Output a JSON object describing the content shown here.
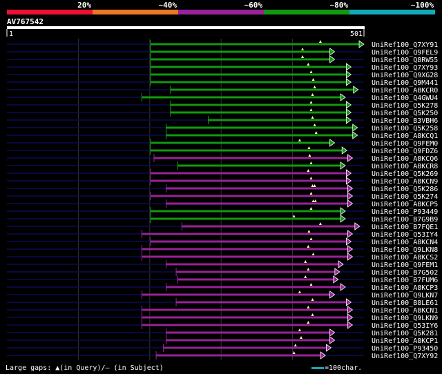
{
  "chart_data": {
    "type": "alignment-overview",
    "query_id": "AV767542",
    "query_start": "1",
    "query_end": "501",
    "query_length": 501,
    "identity_legend": [
      {
        "label": "20%",
        "color": "#ee1133"
      },
      {
        "label": "~40%",
        "color": "#ee7722"
      },
      {
        "label": "~60%",
        "color": "#992299"
      },
      {
        "label": "~80%",
        "color": "#119911"
      },
      {
        "label": "~100%",
        "color": "#11aabb"
      }
    ],
    "footer_text": "Large gaps: ▲(in Query)/— (in Subject)",
    "scale_text": "=100char.",
    "hits": [
      {
        "name": "UniRef100_Q7XY91",
        "start": 202,
        "end": 501,
        "identity": "~80%",
        "gaps": [
          440
        ]
      },
      {
        "name": "UniRef100_Q9FEL9",
        "start": 202,
        "end": 460,
        "identity": "~80%",
        "gaps": [
          415
        ]
      },
      {
        "name": "UniRef100_Q8RW55",
        "start": 202,
        "end": 460,
        "identity": "~80%",
        "gaps": [
          415
        ]
      },
      {
        "name": "UniRef100_Q7XY93",
        "start": 202,
        "end": 483,
        "identity": "~80%",
        "gaps": [
          423
        ]
      },
      {
        "name": "UniRef100_Q9XG28",
        "start": 202,
        "end": 483,
        "identity": "~80%",
        "gaps": [
          427
        ]
      },
      {
        "name": "UniRef100_Q9M441",
        "start": 202,
        "end": 483,
        "identity": "~80%",
        "gaps": [
          430
        ]
      },
      {
        "name": "UniRef100_A8KCR0",
        "start": 230,
        "end": 493,
        "identity": "~80%",
        "gaps": [
          432
        ]
      },
      {
        "name": "UniRef100_Q4GWU4",
        "start": 190,
        "end": 475,
        "identity": "~80%",
        "gaps": [
          429
        ]
      },
      {
        "name": "UniRef100_Q5K278",
        "start": 230,
        "end": 483,
        "identity": "~80%",
        "gaps": [
          427
        ]
      },
      {
        "name": "UniRef100_Q5K250",
        "start": 230,
        "end": 483,
        "identity": "~80%",
        "gaps": [
          427
        ]
      },
      {
        "name": "UniRef100_B3VBH6",
        "start": 283,
        "end": 483,
        "identity": "~80%",
        "gaps": [
          429
        ]
      },
      {
        "name": "UniRef100_Q5K258",
        "start": 224,
        "end": 492,
        "identity": "~80%",
        "gaps": [
          432
        ]
      },
      {
        "name": "UniRef100_A8KCQ1",
        "start": 224,
        "end": 492,
        "identity": "~80%",
        "gaps": [
          434
        ]
      },
      {
        "name": "UniRef100_Q9FEM0",
        "start": 202,
        "end": 460,
        "identity": "~80%",
        "gaps": [
          411
        ]
      },
      {
        "name": "UniRef100_Q9FDZ6",
        "start": 202,
        "end": 477,
        "identity": "~80%",
        "gaps": [
          424
        ]
      },
      {
        "name": "UniRef100_A8KCQ6",
        "start": 207,
        "end": 485,
        "identity": "~60%",
        "gaps": [
          425
        ]
      },
      {
        "name": "UniRef100_A8KCR8",
        "start": 240,
        "end": 475,
        "identity": "~80%",
        "gaps": [
          427
        ]
      },
      {
        "name": "UniRef100_Q5K269",
        "start": 202,
        "end": 483,
        "identity": "~60%",
        "gaps": [
          423
        ]
      },
      {
        "name": "UniRef100_A8KCN9",
        "start": 202,
        "end": 483,
        "identity": "~60%",
        "gaps": [
          427
        ]
      },
      {
        "name": "UniRef100_Q5K286",
        "start": 224,
        "end": 485,
        "identity": "~60%",
        "gaps": [
          429,
          432
        ]
      },
      {
        "name": "UniRef100_Q5K274",
        "start": 202,
        "end": 485,
        "identity": "~60%",
        "gaps": [
          427
        ]
      },
      {
        "name": "UniRef100_A8KCP5",
        "start": 224,
        "end": 485,
        "identity": "~60%",
        "gaps": [
          430,
          433
        ]
      },
      {
        "name": "UniRef100_P93449",
        "start": 202,
        "end": 475,
        "identity": "~80%",
        "gaps": [
          427
        ]
      },
      {
        "name": "UniRef100_B7G9B9",
        "start": 202,
        "end": 475,
        "identity": "~80%",
        "gaps": [
          403
        ]
      },
      {
        "name": "UniRef100_B7FQE1",
        "start": 246,
        "end": 495,
        "identity": "~60%",
        "gaps": [
          440
        ]
      },
      {
        "name": "UniRef100_Q53IY4",
        "start": 190,
        "end": 485,
        "identity": "~60%",
        "gaps": [
          424
        ]
      },
      {
        "name": "UniRef100_A8KCN4",
        "start": 202,
        "end": 483,
        "identity": "~60%",
        "gaps": [
          427
        ]
      },
      {
        "name": "UniRef100_Q9LKN8",
        "start": 190,
        "end": 485,
        "identity": "~60%",
        "gaps": [
          423
        ]
      },
      {
        "name": "UniRef100_A8KCS2",
        "start": 190,
        "end": 485,
        "identity": "~60%",
        "gaps": [
          430
        ]
      },
      {
        "name": "UniRef100_Q9FEM1",
        "start": 224,
        "end": 472,
        "identity": "~60%",
        "gaps": [
          419
        ]
      },
      {
        "name": "UniRef100_B7G502",
        "start": 238,
        "end": 467,
        "identity": "~60%",
        "gaps": [
          423
        ]
      },
      {
        "name": "UniRef100_B7FUM6",
        "start": 240,
        "end": 465,
        "identity": "~60%",
        "gaps": [
          419
        ]
      },
      {
        "name": "UniRef100_A8KCP3",
        "start": 224,
        "end": 475,
        "identity": "~60%",
        "gaps": [
          427
        ]
      },
      {
        "name": "UniRef100_Q9LKN7",
        "start": 190,
        "end": 460,
        "identity": "~60%",
        "gaps": [
          411
        ]
      },
      {
        "name": "UniRef100_B8LE61",
        "start": 238,
        "end": 483,
        "identity": "~60%",
        "gaps": [
          429
        ]
      },
      {
        "name": "UniRef100_A8KCN1",
        "start": 190,
        "end": 485,
        "identity": "~60%",
        "gaps": [
          423
        ]
      },
      {
        "name": "UniRef100_Q9LKN9",
        "start": 190,
        "end": 485,
        "identity": "~60%",
        "gaps": [
          429
        ]
      },
      {
        "name": "UniRef100_Q53IY6",
        "start": 190,
        "end": 485,
        "identity": "~60%",
        "gaps": [
          423
        ]
      },
      {
        "name": "UniRef100_Q5K281",
        "start": 224,
        "end": 460,
        "identity": "~60%",
        "gaps": [
          411
        ]
      },
      {
        "name": "UniRef100_A8KCP1",
        "start": 224,
        "end": 460,
        "identity": "~60%",
        "gaps": [
          413
        ]
      },
      {
        "name": "UniRef100_P93450",
        "start": 220,
        "end": 455,
        "identity": "~60%",
        "gaps": [
          405
        ]
      },
      {
        "name": "UniRef100_Q7XY92",
        "start": 210,
        "end": 447,
        "identity": "~60%",
        "gaps": [
          403
        ]
      }
    ]
  }
}
